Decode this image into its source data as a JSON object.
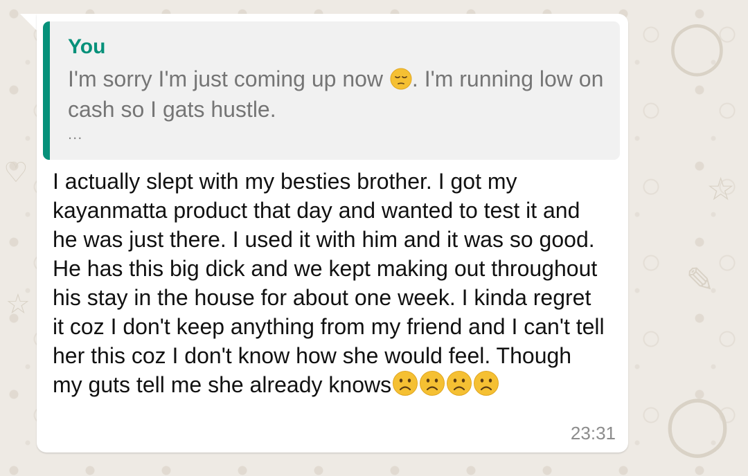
{
  "message": {
    "quoted": {
      "author": "You",
      "text_before_emoji": "I'm sorry I'm just coming up now ",
      "emoji": "pensive-face-emoji",
      "text_after_emoji": ". I'm running low on cash so I gats hustle.",
      "ellipsis": "..."
    },
    "body_text": "I actually slept with my besties brother. I got my kayanmatta product that day and wanted to test it and he was just there. I used it with him and it was so good. He has this big dick and we kept making out throughout his stay in the house for about one week. I kinda regret it coz I don't keep anything from my friend and I can't tell her this coz I don't know how she would feel. Though my guts tell me she already knows",
    "trailing_emojis": [
      "frowning-face-emoji",
      "frowning-face-emoji",
      "frowning-face-emoji",
      "frowning-face-emoji"
    ],
    "timestamp": "23:31"
  },
  "colors": {
    "background": "#efeae2",
    "bubble": "#ffffff",
    "quote_background": "#f1f1f1",
    "quote_accent": "#06917a",
    "quoted_text": "#757575",
    "body_text": "#111111",
    "timestamp": "#8c8c8c",
    "emoji_yellow": "#f5c033"
  }
}
